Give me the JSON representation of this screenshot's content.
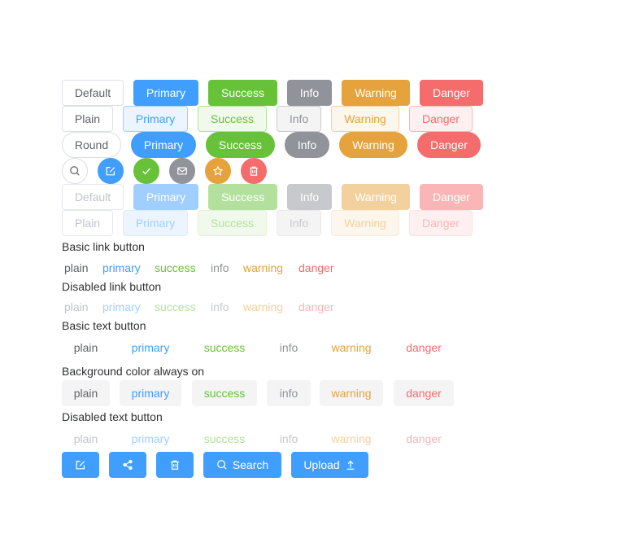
{
  "basic_row": [
    "Default",
    "Primary",
    "Success",
    "Info",
    "Warning",
    "Danger"
  ],
  "plain_row": [
    "Plain",
    "Primary",
    "Success",
    "Info",
    "Warning",
    "Danger"
  ],
  "round_row": [
    "Round",
    "Primary",
    "Success",
    "Info",
    "Warning",
    "Danger"
  ],
  "circle_icons": [
    "search-icon",
    "edit-icon",
    "check-icon",
    "message-icon",
    "star-icon",
    "delete-icon"
  ],
  "disabled_row": [
    "Default",
    "Primary",
    "Success",
    "Info",
    "Warning",
    "Danger"
  ],
  "disabled_plain_row": [
    "Plain",
    "Primary",
    "Success",
    "Info",
    "Warning",
    "Danger"
  ],
  "sections": {
    "basic_link": "Basic link button",
    "disabled_link": "Disabled link button",
    "basic_text": "Basic text button",
    "bg_text": "Background color always on",
    "disabled_text": "Disabled text button"
  },
  "link_items": [
    "plain",
    "primary",
    "success",
    "info",
    "warning",
    "danger"
  ],
  "text_items": [
    "plain",
    "primary",
    "success",
    "info",
    "warning",
    "danger"
  ],
  "icon_buttons": {
    "icons": [
      "edit-icon",
      "share-icon",
      "delete-icon"
    ],
    "search_label": "Search",
    "upload_label": "Upload"
  },
  "colors": {
    "primary": "#409eff",
    "success": "#67c23a",
    "info": "#909399",
    "warning": "#e6a23c",
    "danger": "#f56c6c",
    "text": "#303133"
  }
}
